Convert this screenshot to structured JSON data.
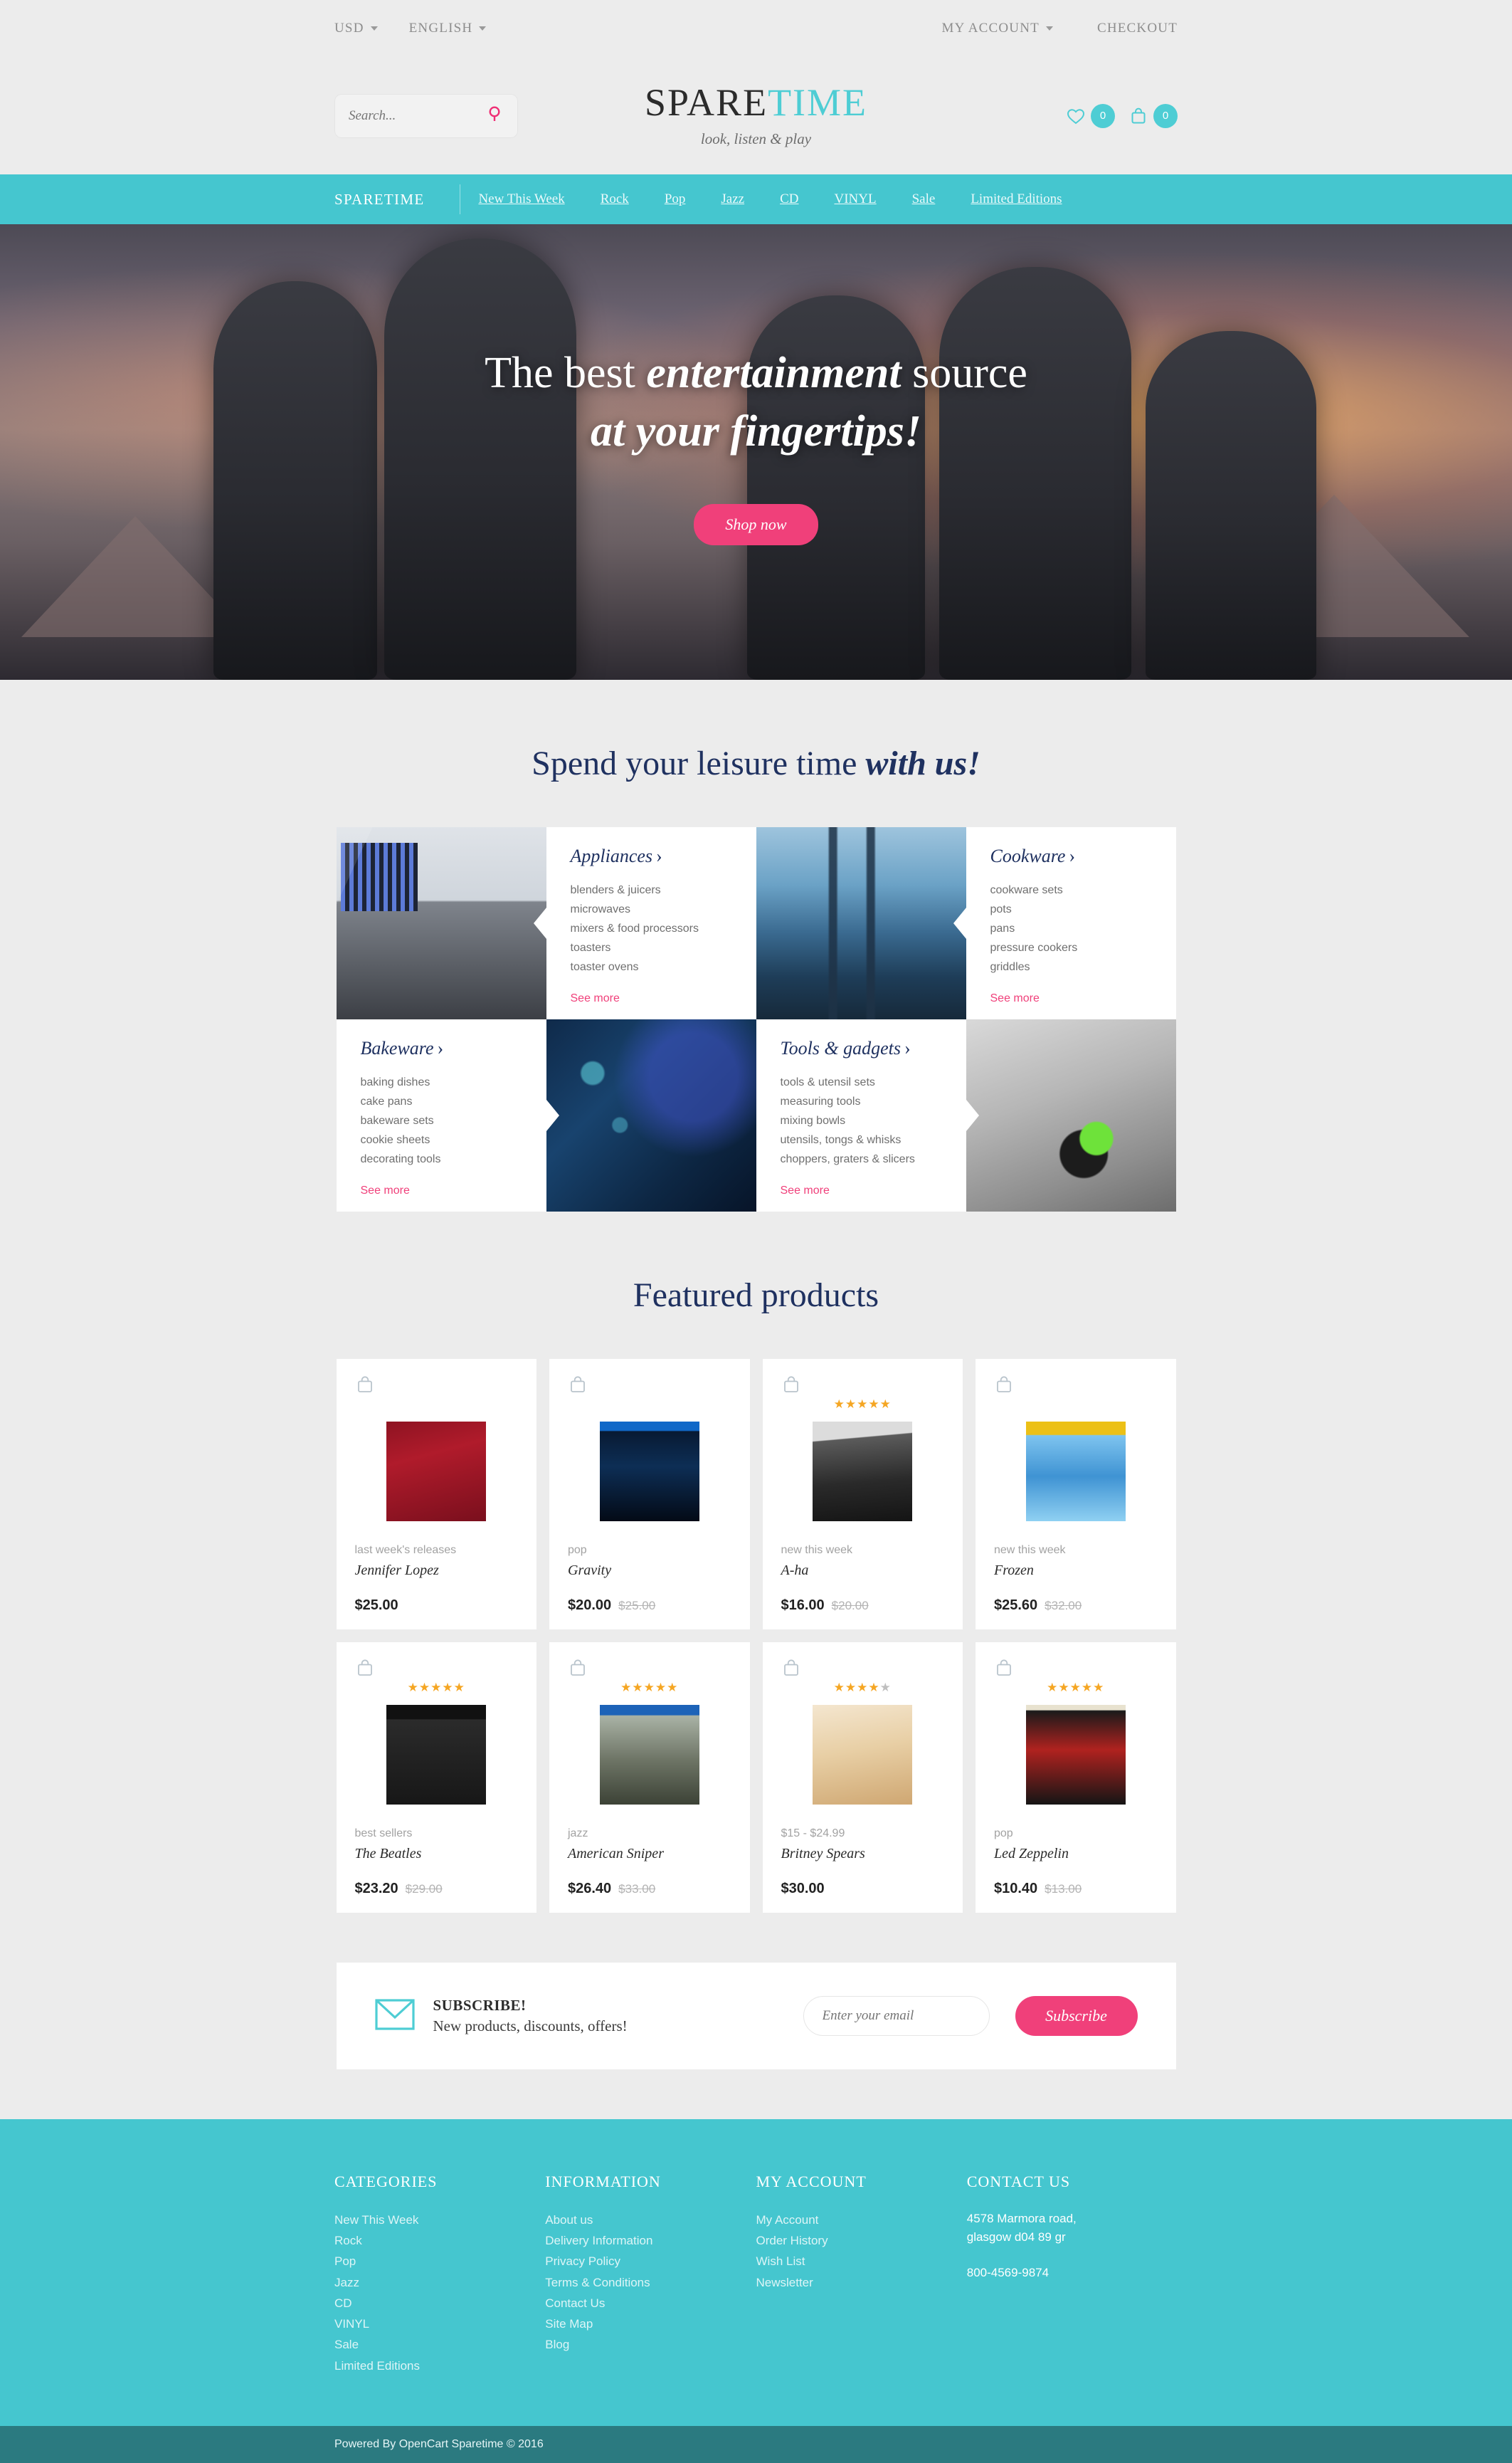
{
  "topbar": {
    "currency": "USD",
    "language": "ENGLISH",
    "my_account": "MY ACCOUNT",
    "checkout": "CHECKOUT"
  },
  "header": {
    "search_placeholder": "Search...",
    "logo_part1": "SPARE",
    "logo_part2": "TIME",
    "tagline": "look, listen & play",
    "wishlist_count": "0",
    "cart_count": "0"
  },
  "nav": {
    "brand": "SPARETIME",
    "items": [
      {
        "label": "New This Week"
      },
      {
        "label": "Rock"
      },
      {
        "label": "Pop"
      },
      {
        "label": "Jazz"
      },
      {
        "label": "CD"
      },
      {
        "label": "VINYL"
      },
      {
        "label": "Sale"
      },
      {
        "label": "Limited Editions"
      }
    ]
  },
  "hero": {
    "line1_a": "The best ",
    "line1_em": "entertainment",
    "line1_b": " source",
    "line2": "at your fingertips!",
    "cta": "Shop now"
  },
  "categories_section": {
    "title_a": "Spend your leisure time ",
    "title_em": "with us!",
    "see_more": "See more",
    "blocks": [
      {
        "title": "Appliances",
        "items": [
          "blenders & juicers",
          "microwaves",
          "mixers & food processors",
          "toasters",
          "toaster ovens"
        ],
        "image_alt": "recording-studio-mixer-photo"
      },
      {
        "title": "Cookware",
        "items": [
          "cookware sets",
          "pots",
          "pans",
          "pressure cookers",
          "griddles"
        ],
        "image_alt": "bridge-movie-poster-photo"
      },
      {
        "title": "Bakeware",
        "items": [
          "baking dishes",
          "cake pans",
          "bakeware sets",
          "cookie sheets",
          "decorating tools"
        ],
        "image_alt": "great-gatsby-couple-photo"
      },
      {
        "title": "Tools & gadgets",
        "items": [
          "tools & utensil sets",
          "measuring tools",
          "mixing bowls",
          "utensils, tongs & whisks",
          "choppers, graters & slicers"
        ],
        "image_alt": "green-headphones-photo"
      }
    ]
  },
  "featured": {
    "title": "Featured products",
    "products": [
      {
        "category": "last week's releases",
        "name": "Jennifer Lopez",
        "price": "$25.00",
        "old_price": "",
        "rating": 0,
        "cover": "cv-jlo"
      },
      {
        "category": "pop",
        "name": "Gravity",
        "price": "$20.00",
        "old_price": "$25.00",
        "rating": 0,
        "cover": "cv-grav"
      },
      {
        "category": "new this week",
        "name": "A-ha",
        "price": "$16.00",
        "old_price": "$20.00",
        "rating": 5,
        "cover": "cv-aha"
      },
      {
        "category": "new this week",
        "name": "Frozen",
        "price": "$25.60",
        "old_price": "$32.00",
        "rating": 0,
        "cover": "cv-froz"
      },
      {
        "category": "best sellers",
        "name": "The Beatles",
        "price": "$23.20",
        "old_price": "$29.00",
        "rating": 5,
        "cover": "cv-beat"
      },
      {
        "category": "jazz",
        "name": "American Sniper",
        "price": "$26.40",
        "old_price": "$33.00",
        "rating": 5,
        "cover": "cv-snip"
      },
      {
        "category": "$15 - $24.99",
        "name": "Britney Spears",
        "price": "$30.00",
        "old_price": "",
        "rating": 4,
        "cover": "cv-brit"
      },
      {
        "category": "pop",
        "name": "Led Zeppelin",
        "price": "$10.40",
        "old_price": "$13.00",
        "rating": 5,
        "cover": "cv-zepp"
      }
    ]
  },
  "subscribe": {
    "title": "SUBSCRIBE!",
    "subtitle": "New products, discounts, offers!",
    "placeholder": "Enter your email",
    "button": "Subscribe"
  },
  "footer": {
    "col1_head": "CATEGORIES",
    "col1_links": [
      "New This Week",
      "Rock",
      "Pop",
      "Jazz",
      "CD",
      "VINYL",
      "Sale",
      "Limited Editions"
    ],
    "col2_head": "INFORMATION",
    "col2_links": [
      "About us",
      "Delivery Information",
      "Privacy Policy",
      "Terms & Conditions",
      "Contact Us",
      "Site Map",
      "Blog"
    ],
    "col3_head": "MY ACCOUNT",
    "col3_links": [
      "My Account",
      "Order History",
      "Wish List",
      "Newsletter"
    ],
    "col4_head": "CONTACT US",
    "address_line1": "4578 Marmora road,",
    "address_line2": "glasgow d04 89 gr",
    "phone": "800-4569-9874",
    "copyright": "Powered By OpenCart Sparetime © 2016"
  },
  "colors": {
    "teal": "#45c6cf",
    "pink": "#f0407a",
    "navy": "#1f3160",
    "page_bg": "#ececec",
    "footer_bottom": "#2b7a80",
    "star": "#f5a623"
  }
}
